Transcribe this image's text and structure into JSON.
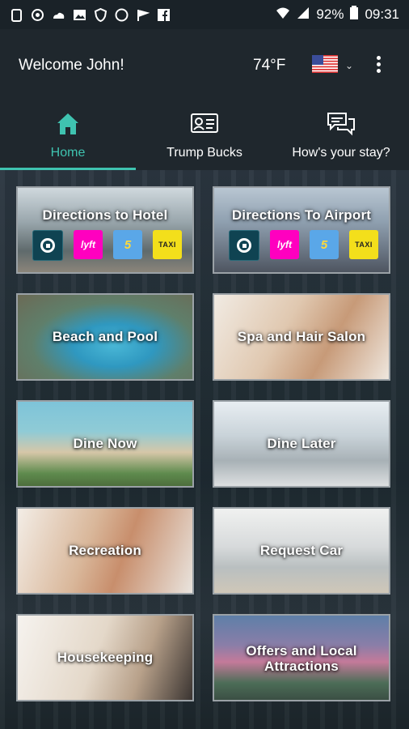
{
  "status": {
    "battery": "92%",
    "time": "09:31"
  },
  "header": {
    "welcome": "Welcome John!",
    "temperature": "74°F"
  },
  "tabs": [
    {
      "label": "Home",
      "icon": "home-icon"
    },
    {
      "label": "Trump Bucks",
      "icon": "id-card-icon"
    },
    {
      "label": "How's your stay?",
      "icon": "chat-bubbles-icon"
    }
  ],
  "tiles": [
    {
      "label": "Directions to Hotel"
    },
    {
      "label": "Directions To Airport"
    },
    {
      "label": "Beach and Pool"
    },
    {
      "label": "Spa and Hair Salon"
    },
    {
      "label": "Dine Now"
    },
    {
      "label": "Dine Later"
    },
    {
      "label": "Recreation"
    },
    {
      "label": "Request Car"
    },
    {
      "label": "Housekeeping"
    },
    {
      "label": "Offers and Local Attractions",
      "line1": "Offers and Local",
      "line2": "Attractions"
    }
  ],
  "rides": {
    "lyft": "lyft",
    "fives": "5",
    "taxi": "TAXI"
  },
  "colors": {
    "accent": "#3fc3b0",
    "lyft": "#ff00bf",
    "taxi": "#f3df1b",
    "uber": "#0f4352"
  }
}
